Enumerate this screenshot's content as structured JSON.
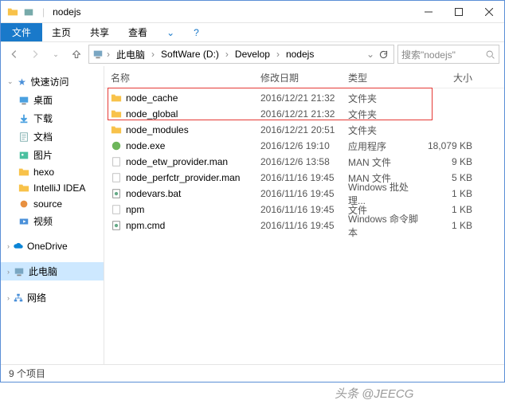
{
  "title": "nodejs",
  "menu": {
    "file": "文件",
    "home": "主页",
    "share": "共享",
    "view": "查看"
  },
  "breadcrumb": [
    "此电脑",
    "SoftWare (D:)",
    "Develop",
    "nodejs"
  ],
  "search_placeholder": "搜索\"nodejs\"",
  "columns": {
    "name": "名称",
    "date": "修改日期",
    "type": "类型",
    "size": "大小"
  },
  "sidebar": {
    "quick": {
      "label": "快速访问",
      "items": [
        {
          "label": "桌面",
          "icon": "desktop"
        },
        {
          "label": "下载",
          "icon": "download"
        },
        {
          "label": "文档",
          "icon": "document"
        },
        {
          "label": "图片",
          "icon": "picture"
        },
        {
          "label": "hexo",
          "icon": "folder"
        },
        {
          "label": "IntelliJ IDEA",
          "icon": "folder"
        },
        {
          "label": "source",
          "icon": "source"
        },
        {
          "label": "视频",
          "icon": "video"
        }
      ]
    },
    "onedrive": "OneDrive",
    "thispc": "此电脑",
    "network": "网络"
  },
  "files": [
    {
      "name": "node_cache",
      "date": "2016/12/21 21:32",
      "type": "文件夹",
      "size": "",
      "icon": "folder",
      "hl": true
    },
    {
      "name": "node_global",
      "date": "2016/12/21 21:32",
      "type": "文件夹",
      "size": "",
      "icon": "folder",
      "hl": true
    },
    {
      "name": "node_modules",
      "date": "2016/12/21 20:51",
      "type": "文件夹",
      "size": "",
      "icon": "folder"
    },
    {
      "name": "node.exe",
      "date": "2016/12/6 19:10",
      "type": "应用程序",
      "size": "18,079 KB",
      "icon": "exe"
    },
    {
      "name": "node_etw_provider.man",
      "date": "2016/12/6 13:58",
      "type": "MAN 文件",
      "size": "9 KB",
      "icon": "file"
    },
    {
      "name": "node_perfctr_provider.man",
      "date": "2016/11/16 19:45",
      "type": "MAN 文件",
      "size": "5 KB",
      "icon": "file"
    },
    {
      "name": "nodevars.bat",
      "date": "2016/11/16 19:45",
      "type": "Windows 批处理...",
      "size": "1 KB",
      "icon": "system"
    },
    {
      "name": "npm",
      "date": "2016/11/16 19:45",
      "type": "文件",
      "size": "1 KB",
      "icon": "file"
    },
    {
      "name": "npm.cmd",
      "date": "2016/11/16 19:45",
      "type": "Windows 命令脚本",
      "size": "1 KB",
      "icon": "system"
    }
  ],
  "status": "9 个项目",
  "watermark": "头条 @JEECG"
}
